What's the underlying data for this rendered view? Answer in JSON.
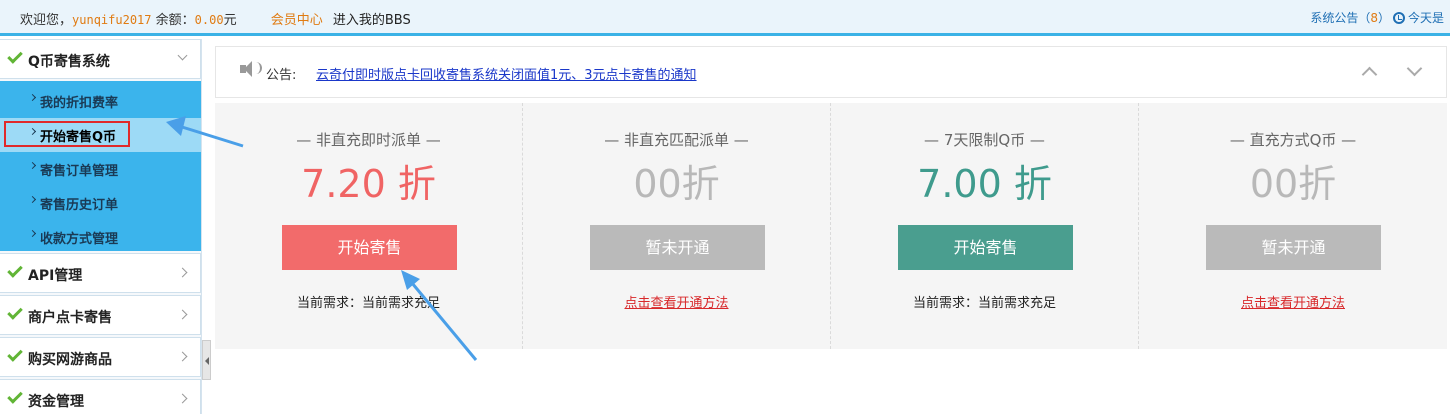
{
  "topbar": {
    "welcome": "欢迎您，",
    "username": "yunqifu2017",
    "balance_label": "余额：",
    "balance_value": "0.00",
    "balance_unit": "元",
    "member_center": "会员中心",
    "bbs": "进入我的BBS",
    "announce_label": "系统公告（",
    "announce_count": "8",
    "announce_close": "）",
    "today": "今天是"
  },
  "sidebar": {
    "groups": [
      {
        "label": "Q币寄售系统",
        "open": true
      },
      {
        "label": "API管理"
      },
      {
        "label": "商户点卡寄售"
      },
      {
        "label": "购买网游商品"
      },
      {
        "label": "资金管理"
      }
    ],
    "subitems": [
      {
        "label": "我的折扣费率"
      },
      {
        "label": "开始寄售Q币",
        "active": true
      },
      {
        "label": "寄售订单管理"
      },
      {
        "label": "寄售历史订单"
      },
      {
        "label": "收款方式管理"
      }
    ]
  },
  "notice": {
    "label": "公告:",
    "text": "云奇付即时版点卡回收寄售系统关闭面值1元、3元点卡寄售的通知"
  },
  "cards": [
    {
      "title": "— 非直充即时派单 —",
      "rate": "7.20 折",
      "rate_color": "#f06464",
      "button": "开始寄售",
      "button_color": "#f26b6b",
      "footer": "当前需求：当前需求充足",
      "footer_link": false
    },
    {
      "title": "— 非直充匹配派单 —",
      "rate": "00折",
      "rate_color": "#b8b8b8",
      "button": "暂未开通",
      "button_color": "#bababa",
      "footer": "点击查看开通方法",
      "footer_link": true
    },
    {
      "title": "— 7天限制Q币 —",
      "rate": "7.00 折",
      "rate_color": "#3f9b8d",
      "button": "开始寄售",
      "button_color": "#4a9e8f",
      "footer": "当前需求：当前需求充足",
      "footer_link": false
    },
    {
      "title": "— 直充方式Q币 —",
      "rate": "00折",
      "rate_color": "#b8b8b8",
      "button": "暂未开通",
      "button_color": "#bababa",
      "footer": "点击查看开通方法",
      "footer_link": true
    }
  ],
  "colors": {
    "accent": "#3bb2e6",
    "annotation_arrow": "#4a9fe8",
    "highlight_frame": "#e0292a"
  }
}
